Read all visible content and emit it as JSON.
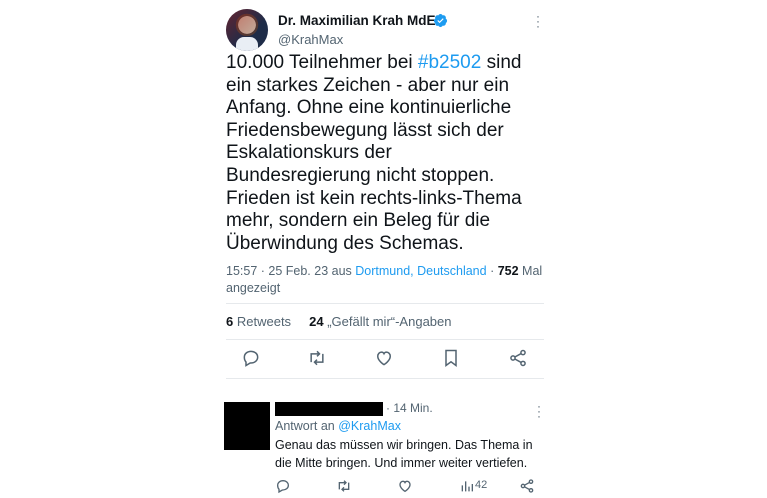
{
  "tweet": {
    "author_name": "Dr. Maximilian Krah MdEP",
    "handle": "@KrahMax",
    "text_before_tag": "10.000 Teilnehmer bei ",
    "hashtag": "#b2502",
    "text_after_tag": " sind ein starkes Zeichen - aber nur ein Anfang. Ohne eine kontinuierliche Friedensbewegung lässt sich der Eskalationskurs der Bundesregierung nicht stoppen. Frieden ist kein rechts-links-Thema mehr, sondern ein Beleg für die Überwindung des Schemas.",
    "timestamp": "15:57 · 25 Feb. 23 aus ",
    "location": "Dortmund, Deutschland",
    "views_separator": " · ",
    "views_count": "752",
    "views_label": " Mal angezeigt",
    "retweets_count": "6",
    "retweets_label": "Retweets",
    "likes_count": "24",
    "likes_label": "„Gefällt mir“-Angaben"
  },
  "actions": [
    "reply-icon",
    "retweet-icon",
    "like-icon",
    "bookmark-icon",
    "share-icon"
  ],
  "reply": {
    "time": "· 14 Min.",
    "reply_to_prefix": "Antwort an ",
    "reply_to_handle": "@KrahMax",
    "text": "Genau das müssen wir bringen. Das Thema in die Mitte bringen. Und immer weiter vertiefen.",
    "views_count": "42"
  },
  "colors": {
    "accent": "#1d9bf0",
    "text": "#0f1419",
    "secondary": "#536471",
    "divider": "#e6e9ec"
  }
}
